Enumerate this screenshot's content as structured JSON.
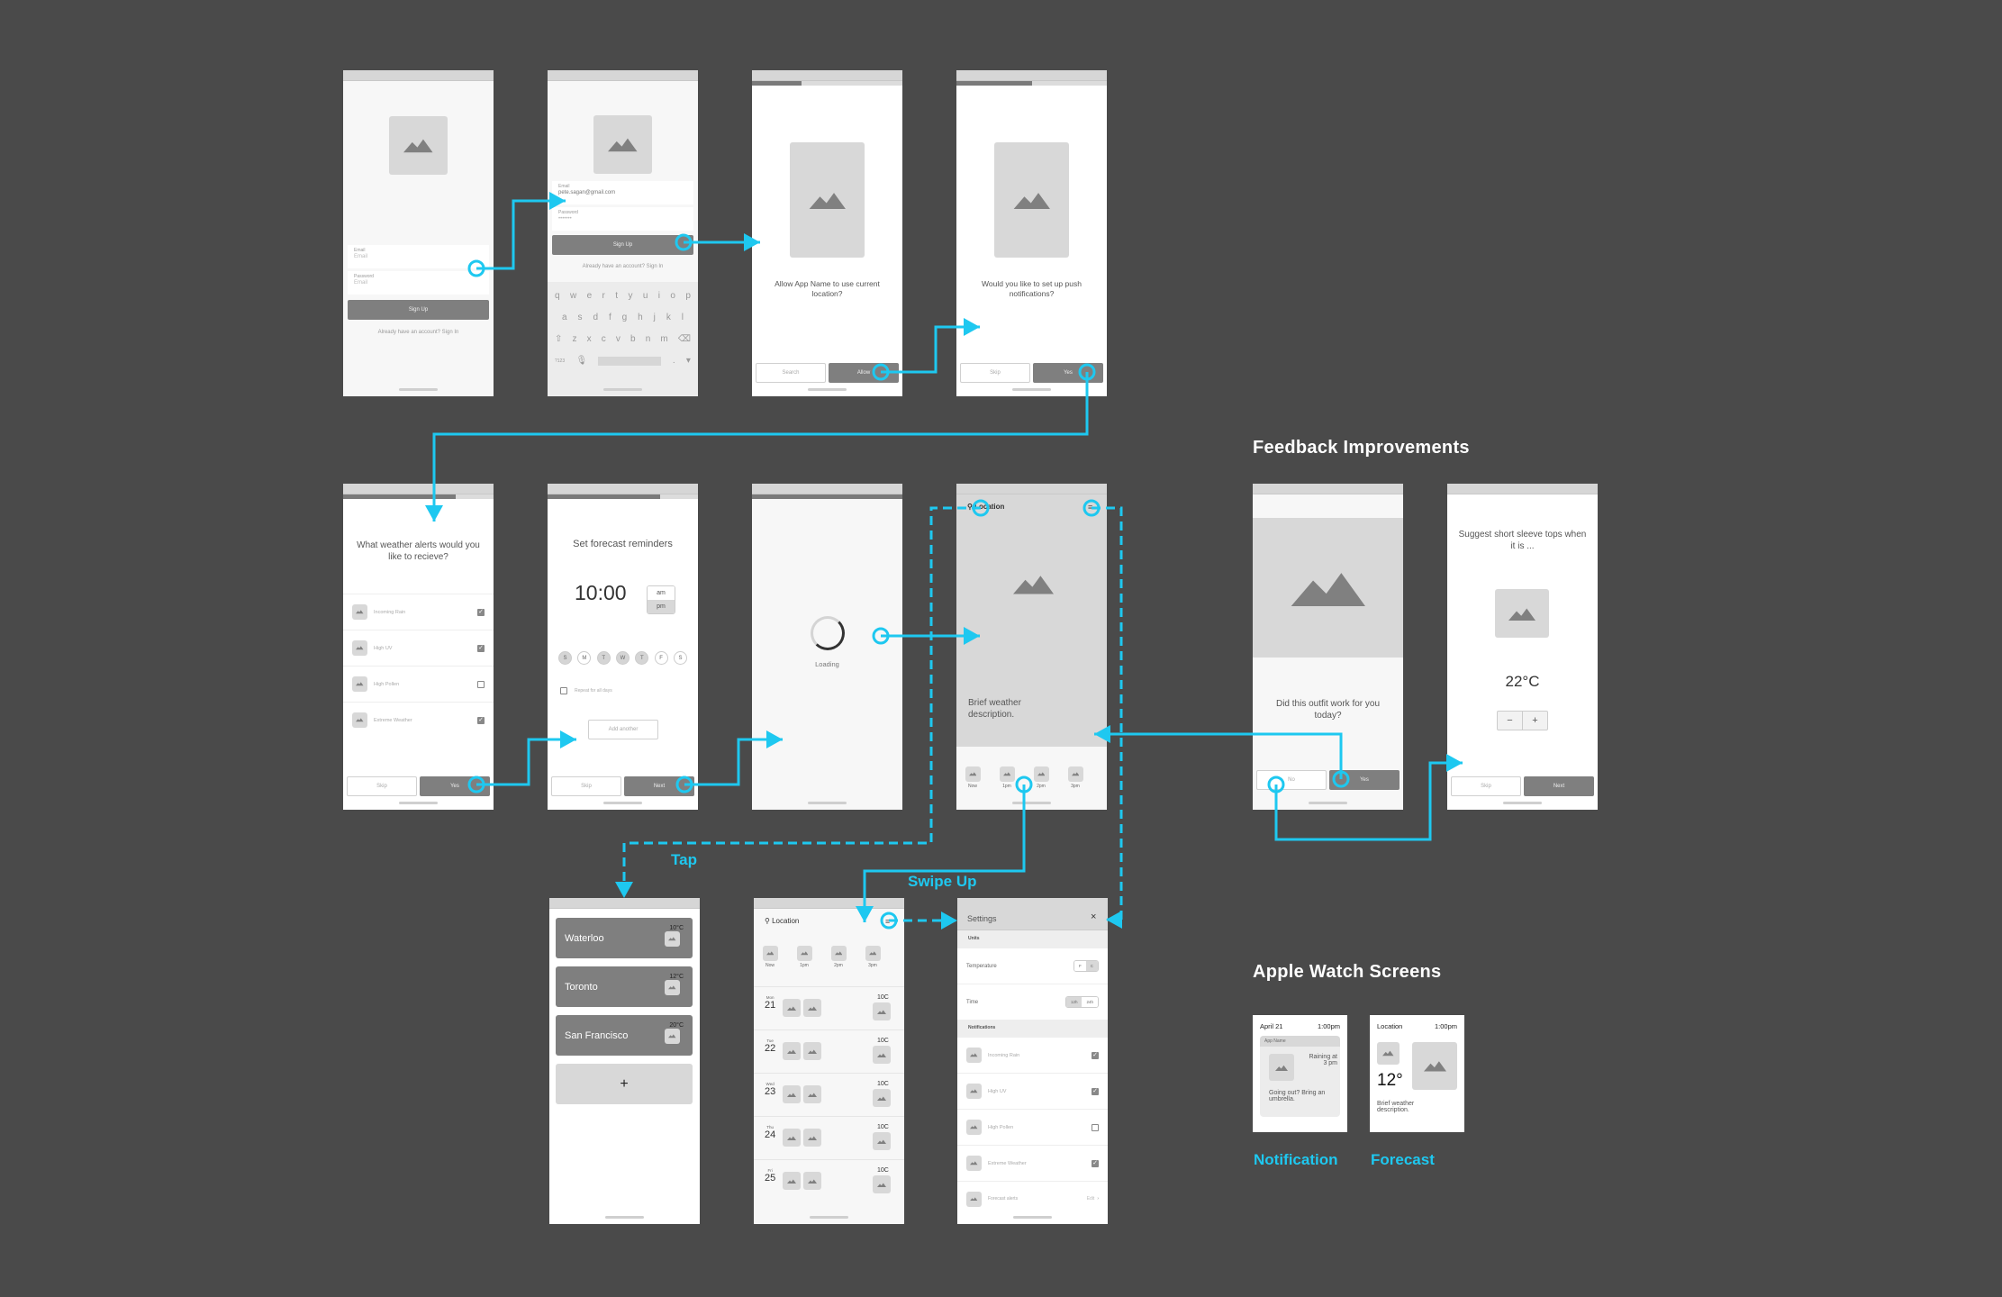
{
  "accent": "#1ec8f0",
  "signup": {
    "email_label": "Email",
    "email_placeholder": "Email",
    "password_label": "Password",
    "password_placeholder": "Email",
    "button": "Sign Up",
    "signin_link": "Already have an account? Sign In"
  },
  "signup_filled": {
    "email_label": "Email",
    "email_value": "pete.sagan@gmail.com",
    "password_label": "Password",
    "password_value": "•••••••",
    "button": "Sign Up",
    "signin_link": "Already have an account? Sign In",
    "keyboard": {
      "row1": [
        "q",
        "w",
        "e",
        "r",
        "t",
        "y",
        "u",
        "i",
        "o",
        "p"
      ],
      "row2": [
        "a",
        "s",
        "d",
        "f",
        "g",
        "h",
        "j",
        "k",
        "l"
      ],
      "row3": [
        "⇧",
        "z",
        "x",
        "c",
        "v",
        "b",
        "n",
        "m",
        "⌫"
      ],
      "num_key": "?123"
    }
  },
  "location_permission": {
    "question": "Allow App Name to use current location?",
    "secondary": "Search",
    "primary": "Allow",
    "progress": 0.33
  },
  "push_permission": {
    "question": "Would you like to set up push notifications?",
    "secondary": "Skip",
    "primary": "Yes",
    "progress": 0.5
  },
  "alerts": {
    "question": "What weather alerts would you like to recieve?",
    "progress": 0.75,
    "items": [
      {
        "label": "Incoming Rain",
        "checked": true
      },
      {
        "label": "High UV",
        "checked": true
      },
      {
        "label": "High Pollen",
        "checked": false
      },
      {
        "label": "Extreme Weather",
        "checked": true
      }
    ],
    "secondary": "Skip",
    "primary": "Yes"
  },
  "reminders": {
    "title": "Set forecast reminders",
    "time": "10:00",
    "am": "am",
    "pm": "pm",
    "days": [
      {
        "l": "S",
        "on": true
      },
      {
        "l": "M",
        "on": false
      },
      {
        "l": "T",
        "on": true
      },
      {
        "l": "W",
        "on": true
      },
      {
        "l": "T",
        "on": true
      },
      {
        "l": "F",
        "on": false
      },
      {
        "l": "S",
        "on": false
      }
    ],
    "repeat": "Repeat for all days",
    "add": "Add another",
    "secondary": "Skip",
    "primary": "Next",
    "progress": 0.75
  },
  "loading": {
    "label": "Loading",
    "progress": 1
  },
  "home": {
    "location": "Location",
    "description": "Brief weather description.",
    "hourly": [
      {
        "t": "10C",
        "h": "Now"
      },
      {
        "t": "11C",
        "h": "1pm"
      },
      {
        "t": "13C",
        "h": "2pm"
      },
      {
        "t": "11C",
        "h": "3pm"
      }
    ]
  },
  "feedback": {
    "title": "Feedback Improvements",
    "question": "Did this outfit work for you today?",
    "no": "No",
    "yes": "Yes",
    "suggest": "Suggest short sleeve tops when it is ...",
    "temp": "22°C",
    "minus": "−",
    "plus": "+",
    "secondary": "Skip",
    "primary": "Next"
  },
  "cities": {
    "items": [
      {
        "name": "Waterloo",
        "temp": "10°C"
      },
      {
        "name": "Toronto",
        "temp": "12°C"
      },
      {
        "name": "San Francisco",
        "temp": "20°C"
      }
    ],
    "add": "+"
  },
  "forecast": {
    "location": "Location",
    "hourly": [
      {
        "t": "10C",
        "h": "Now"
      },
      {
        "t": "11C",
        "h": "1pm"
      },
      {
        "t": "13C",
        "h": "2pm"
      },
      {
        "t": "11C",
        "h": "3pm"
      }
    ],
    "days": [
      {
        "d": "Mon",
        "n": "21",
        "t": "10C"
      },
      {
        "d": "Tue",
        "n": "22",
        "t": "10C"
      },
      {
        "d": "Wed",
        "n": "23",
        "t": "10C"
      },
      {
        "d": "Thu",
        "n": "24",
        "t": "10C"
      },
      {
        "d": "Fri",
        "n": "25",
        "t": "10C"
      }
    ]
  },
  "settings": {
    "title": "Settings",
    "close": "×",
    "units": "Units",
    "temperature": "Temperature",
    "temp_opts": [
      "F",
      "C"
    ],
    "time": "Time",
    "time_opts": [
      "12h",
      "24h"
    ],
    "notifications": "Notifications",
    "items": [
      {
        "label": "Incoming Rain",
        "checked": true
      },
      {
        "label": "High UV",
        "checked": true
      },
      {
        "label": "High Pollen",
        "checked": false
      },
      {
        "label": "Extreme Weather",
        "checked": true
      }
    ],
    "forecast_alerts": "Forecast alerts",
    "edit": "Edit"
  },
  "labels": {
    "tap": "Tap",
    "swipe_up": "Swipe Up"
  },
  "watch": {
    "title": "Apple Watch Screens",
    "notification": {
      "date": "April 21",
      "time": "1:00pm",
      "app": "App Name",
      "alert": "Raining at 3 pm",
      "body": "Going out? Bring an umbrella.",
      "caption": "Notification"
    },
    "forecast": {
      "location": "Location",
      "time": "1:00pm",
      "temp": "12°",
      "description": "Brief weather description.",
      "caption": "Forecast"
    }
  }
}
